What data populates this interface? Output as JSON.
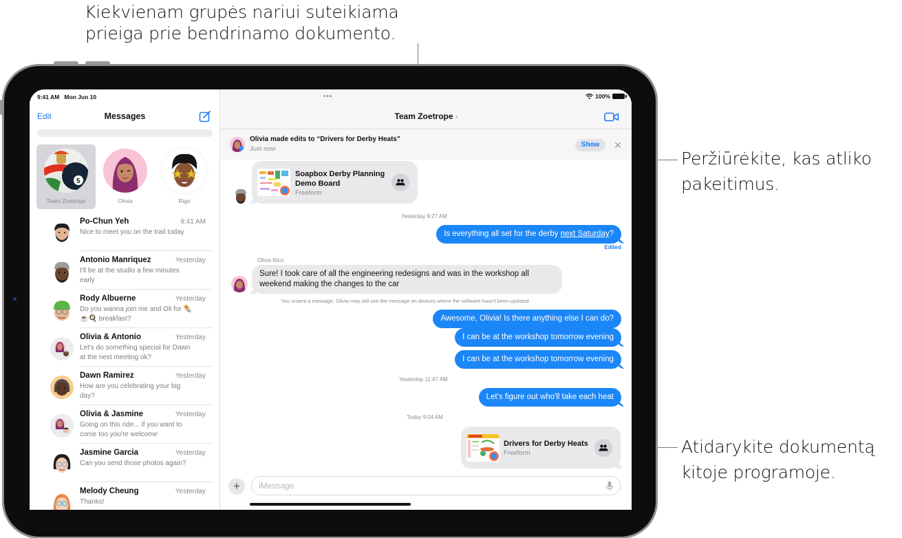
{
  "callouts": {
    "top_line1": "Kiekvienam grupės nariui suteikiama",
    "top_line2": "prieiga prie bendrinamo dokumento.",
    "right_show_line1": "Peržiūrėkite, kas atliko",
    "right_show_line2": "pakeitimus.",
    "right_doc_line1": "Atidarykite dokumentą",
    "right_doc_line2": "kitoje programoje."
  },
  "status_bar": {
    "time": "9:41 AM",
    "date": "Mon Jun 10",
    "battery": "100%",
    "multitask_dots": "•••"
  },
  "sidebar": {
    "edit_label": "Edit",
    "title": "Messages",
    "compose_icon": "square-and-pencil-icon",
    "pinned": [
      {
        "name": "Team Zoetrope",
        "selected": true
      },
      {
        "name": "Olivia",
        "selected": false
      },
      {
        "name": "Rigo",
        "selected": false
      }
    ],
    "conversations": [
      {
        "name": "Po-Chun Yeh",
        "time": "9:41 AM",
        "preview": "Nice to meet you on the trail today"
      },
      {
        "name": "Antonio Manriquez",
        "time": "Yesterday",
        "preview": "I'll be at the studio a few minutes early"
      },
      {
        "name": "Rody Albuerne",
        "time": "Yesterday",
        "preview": "Do you wanna join me and Oli for 🌯☕🍳 breakfast?"
      },
      {
        "name": "Olivia & Antonio",
        "time": "Yesterday",
        "preview": "Let's do something special for Dawn at the next meeting ok?"
      },
      {
        "name": "Dawn Ramirez",
        "time": "Yesterday",
        "preview": "How are you celebrating your big day?"
      },
      {
        "name": "Olivia & Jasmine",
        "time": "Yesterday",
        "preview": "Going on this ride... if you want to come too you're welcome"
      },
      {
        "name": "Jasmine Garcia",
        "time": "Yesterday",
        "preview": "Can you send those photos again?"
      },
      {
        "name": "Melody Cheung",
        "time": "Yesterday",
        "preview": "Thanks!"
      }
    ]
  },
  "chat": {
    "title": "Team Zoetrope",
    "title_chevron": "›",
    "facetime_icon": "video-camera-icon",
    "banner": {
      "title": "Olivia made edits to “Drivers for Derby Heats”",
      "subtitle": "Just now",
      "show_label": "Show",
      "close_label": "✕"
    },
    "card1": {
      "title_line1": "Soapbox Derby Planning",
      "title_line2": "Demo Board",
      "app": "Freeform"
    },
    "ts1": "Yesterday 9:27 AM",
    "msg_out1_pre": "Is everything all set for the derby ",
    "msg_out1_link": "next Saturday",
    "msg_out1_post": "?",
    "edited_label": "Edited",
    "sender_olivia": "Olivia Rico",
    "msg_in1": "Sure! I took care of all the engineering redesigns and was in the workshop all weekend making the changes to the car",
    "unsent_note": "You unsent a message. Olivia may still see the message on devices where the software hasn't been updated.",
    "msg_out2": "Awesome, Olivia! Is there anything else I can do?",
    "msg_out3": "I can be at the workshop tomorrow evening",
    "msg_out4": "I can be at the workshop tomorrow evening",
    "ts2": "Yesterday 11:47 AM",
    "msg_out5": "Let's figure out who'll take each heat",
    "ts3": "Today 9:04 AM",
    "card2": {
      "title": "Drivers for Derby Heats",
      "app": "Freeform"
    },
    "compose_placeholder": "iMessage",
    "compose_value": ""
  },
  "colors": {
    "accent_blue": "#1b7cf5",
    "bubble_blue": "#1b86f7",
    "bubble_gray": "#e9e9eb"
  }
}
